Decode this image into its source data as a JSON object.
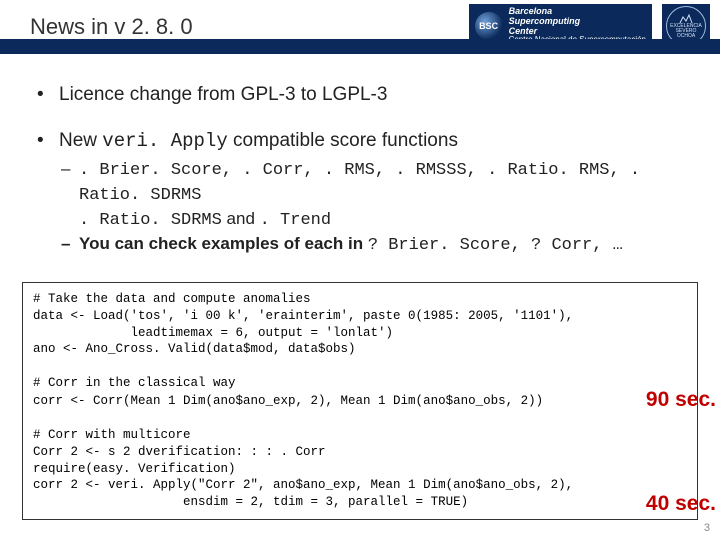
{
  "header": {
    "title": "News in v 2. 8. 0",
    "logo1_abbrev": "BSC",
    "logo1_line1": "Barcelona",
    "logo1_line2": "Supercomputing",
    "logo1_line3": "Center",
    "logo1_line4": "Centro Nacional de Supercomputación",
    "logo2_line1": "EXCELENCIA",
    "logo2_line2": "SEVERO",
    "logo2_line3": "OCHOA"
  },
  "bullets": {
    "b1": "Licence change from GPL-3 to LGPL-3",
    "b2_pre": "New ",
    "b2_code": "veri. Apply",
    "b2_post": " compatible score functions",
    "b2_sub1_code": ". Brier. Score, . Corr, . RMS, . RMSSS, . Ratio. RMS, . Ratio. SDRMS",
    "b2_sub1_mid": " and ",
    "b2_sub1_code2": ". Trend",
    "b2_sub2_pre": "You can check examples of each in ",
    "b2_sub2_code": "? Brier. Score, ? Corr, …"
  },
  "code": {
    "line1": "# Take the data and compute anomalies",
    "line2": "data <- Load('tos', 'i 00 k', 'erainterim', paste 0(1985: 2005, '1101'),",
    "line3": "             leadtimemax = 6, output = 'lonlat')",
    "line4": "ano <- Ano_Cross. Valid(data$mod, data$obs)",
    "line5": "",
    "line6": "# Corr in the classical way",
    "line7": "corr <- Corr(Mean 1 Dim(ano$ano_exp, 2), Mean 1 Dim(ano$ano_obs, 2))",
    "line8": "",
    "line9": "# Corr with multicore",
    "line10": "Corr 2 <- s 2 dverification: : : . Corr",
    "line11": "require(easy. Verification)",
    "line12": "corr 2 <- veri. Apply(\"Corr 2\", ano$ano_exp, Mean 1 Dim(ano$ano_obs, 2),",
    "line13": "                    ensdim = 2, tdim = 3, parallel = TRUE)"
  },
  "labels": {
    "t90": "90 sec.",
    "t40": "40 sec."
  },
  "page": "3"
}
